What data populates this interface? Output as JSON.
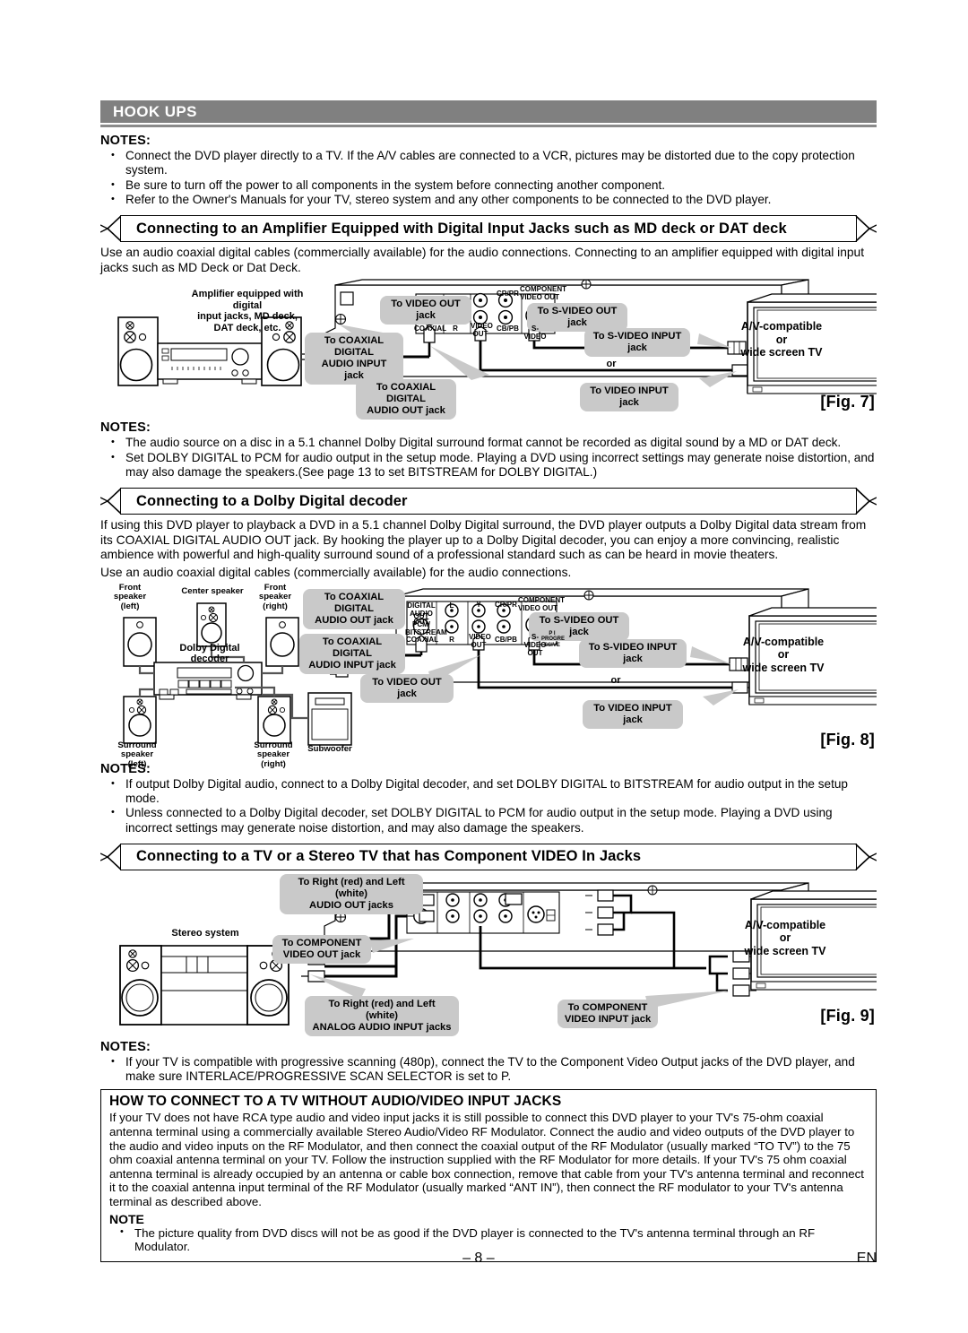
{
  "banner": {
    "title": "HOOK UPS"
  },
  "top_notes": {
    "heading": "NOTES:",
    "items": [
      "Connect the DVD player directly to a TV. If the A/V cables are connected to a VCR, pictures may be distorted due to the copy protection system.",
      "Be sure to turn off the power to all components in the system before connecting another component.",
      "Refer to the Owner's Manuals for your TV, stereo system and any other components to be connected to the DVD player."
    ]
  },
  "section1": {
    "title": "Connecting to an Amplifier Equipped with Digital Input Jacks such as MD deck or DAT deck",
    "body": "Use an audio coaxial digital cables (commercially available) for the audio connections. Connecting to an amplifier equipped with digital input jacks such as MD Deck or Dat Deck.",
    "figure": {
      "label": "[Fig. 7]",
      "amplifier_label": "Amplifier equipped with digital\ninput jacks, MD deck,\nDAT deck, etc.",
      "tv_label": "A/V-compatible\nor\nwide screen TV",
      "or_label": "or",
      "callouts": {
        "coax_digital_audio_input": "To COAXIAL DIGITAL\nAUDIO INPUT jack",
        "coax_digital_audio_out": "To COAXIAL DIGITAL\nAUDIO OUT jack",
        "video_out": "To VIDEO OUT jack",
        "svideo_out": "To S-VIDEO OUT jack",
        "svideo_input": "To S-VIDEO INPUT jack",
        "video_input": "To VIDEO INPUT jack"
      },
      "panel_labels": {
        "coaxial": "COAXIAL",
        "r": "R",
        "video_out": "VIDEO\nOUT",
        "cbpb_crpr": "CB/PB",
        "crpr": "CR/PR",
        "svideo": "S-VIDEO",
        "component": "COMPONENT\nVIDEO OUT"
      }
    }
  },
  "notes_fig7": {
    "heading": "NOTES:",
    "items": [
      "The audio source on a disc in a 5.1 channel Dolby Digital surround format cannot be recorded as digital sound by a MD or DAT deck.",
      "Set DOLBY DIGITAL to PCM for audio output in the setup mode. Playing a DVD using incorrect settings may generate noise distortion, and may also damage the speakers.(See page 13 to set BITSTREAM for DOLBY DIGITAL.)"
    ]
  },
  "section2": {
    "title": "Connecting to a Dolby Digital decoder",
    "body1": "If using this DVD player to playback a DVD in a 5.1 channel Dolby Digital surround, the DVD player outputs a Dolby Digital data stream from its COAXIAL DIGITAL AUDIO OUT jack. By hooking the player up to a Dolby Digital decoder, you can enjoy a more convincing, realistic ambience with powerful and high-quality surround sound of a professional standard such as can be heard in movie theaters.",
    "body2": "Use an audio coaxial digital cables (commercially available) for the audio connections.",
    "figure": {
      "label": "[Fig. 8]",
      "tv_label": "A/V-compatible\nor\nwide screen TV",
      "or_label": "or",
      "speaker_labels": {
        "front_left": "Front\nspeaker\n(left)",
        "center": "Center speaker",
        "front_right": "Front\nspeaker\n(right)",
        "decoder": "Dolby Digital\ndecoder",
        "surround_left": "Surround\nspeaker\n(left)",
        "surround_right": "Surround\nspeaker\n(right)",
        "subwoofer": "Subwoofer"
      },
      "callouts": {
        "coax_digital_audio_out": "To COAXIAL DIGITAL\nAUDIO OUT jack",
        "coax_digital_audio_input": "To COAXIAL DIGITAL\nAUDIO INPUT jack",
        "video_out": "To VIDEO OUT jack",
        "svideo_out": "To S-VIDEO OUT jack",
        "svideo_input": "To S-VIDEO INPUT jack",
        "video_input": "To VIDEO INPUT jack"
      },
      "panel_labels": {
        "digital_audio_out": "DIGITAL\nAUDIO OUT",
        "out_pcm": "OUT PCM/\nBITSTREAM",
        "coaxial": "COAXIAL",
        "l": "L",
        "r": "R",
        "y": "Y",
        "video_out": "VIDEO\nOUT",
        "cbpb": "CB/PB",
        "crpr": "CR/PR",
        "svideo": "S-VIDEO\nOUT",
        "component": "COMPONENT\nVIDEO OUT",
        "progressive": "P  I\nPROGRE\nSSIVE"
      }
    }
  },
  "notes_fig8": {
    "heading": "NOTES:",
    "items": [
      "If output Dolby Digital audio, connect to a Dolby Digital decoder, and set DOLBY DIGITAL to BITSTREAM for audio output in the setup mode.",
      "Unless connected to a Dolby Digital decoder, set DOLBY DIGITAL to PCM for audio output in the setup mode. Playing a DVD using incorrect settings may generate noise distortion, and may also damage the speakers."
    ]
  },
  "section3": {
    "title": "Connecting to a TV or a Stereo TV that has Component VIDEO In Jacks",
    "figure": {
      "label": "[Fig. 9]",
      "stereo_label": "Stereo system",
      "tv_label": "A/V-compatible\nor\nwide screen TV",
      "callouts": {
        "audio_out": "To Right (red) and Left (white)\nAUDIO OUT jacks",
        "analog_audio_input": "To Right (red) and Left (white)\nANALOG AUDIO INPUT jacks",
        "component_video_out": "To COMPONENT\nVIDEO OUT jack",
        "component_video_input": "To COMPONENT\nVIDEO INPUT jack"
      }
    }
  },
  "notes_fig9": {
    "heading": "NOTES:",
    "items": [
      "If your TV is compatible with progressive scanning (480p), connect the TV to the Component Video Output jacks of the DVD player, and make sure INTERLACE/PROGRESSIVE SCAN SELECTOR is set to P."
    ]
  },
  "boxed_section": {
    "title": "HOW TO CONNECT TO A TV WITHOUT AUDIO/VIDEO INPUT JACKS",
    "paragraph": "If your TV does not have RCA type audio and video input jacks it is still possible to connect this DVD player to your TV's 75-ohm coaxial antenna terminal using a commercially available Stereo Audio/Video RF Modulator. Connect the audio and video outputs of the DVD player to the audio and video inputs on the RF Modulator, and then connect the coaxial output of the RF Modulator (usually marked “TO TV”) to the 75 ohm coaxial antenna terminal on your TV. Follow the instruction supplied with the RF Modulator for more details. If your TV's 75 ohm coaxial antenna terminal is already occupied by an antenna or cable box connection, remove that cable from your TV's antenna terminal and reconnect it to the coaxial antenna input terminal of the RF Modulator (usually marked “ANT IN”), then connect the RF modulator to your TV's antenna terminal as described above.",
    "note_heading": "NOTE",
    "note_items": [
      "The picture quality from DVD discs will not be as good if the DVD player is connected to the TV's antenna terminal through an RF Modulator."
    ]
  },
  "footer": {
    "page_number": "– 8 –",
    "language": "EN"
  },
  "colors": {
    "banner_bg": "#808080",
    "banner_text": "#ffffff",
    "callout_bg": "#c9c9c9",
    "page_bg": "#ffffff",
    "ink": "#000000"
  }
}
